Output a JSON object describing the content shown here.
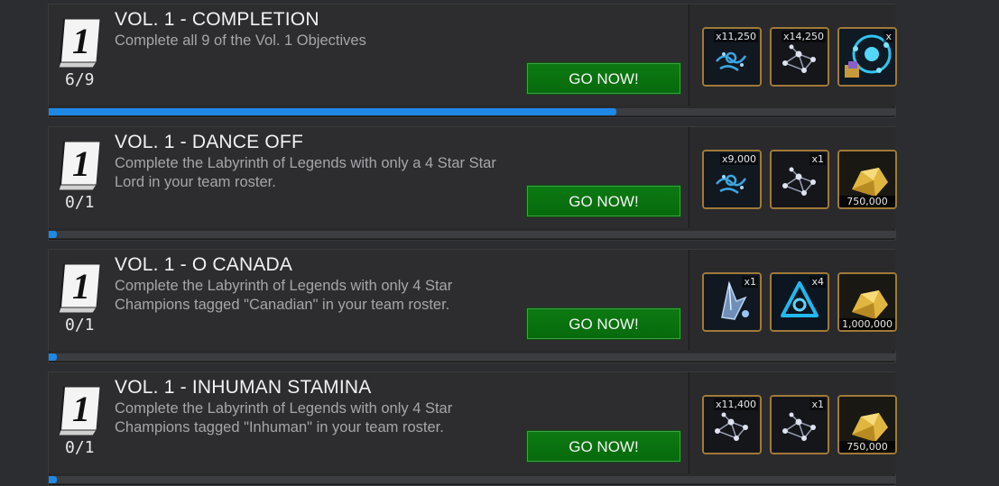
{
  "colors": {
    "accent_progress": "#1e88e5",
    "button_green": "#0b7510",
    "reward_border": "#a07a38"
  },
  "objectives": [
    {
      "book_number": "1",
      "title": "VOL. 1 - COMPLETION",
      "description": "Complete all 9 of the Vol. 1 Objectives",
      "count": "6/9",
      "progress": 0.67,
      "button_label": "GO NOW!",
      "rewards": [
        {
          "icon": "catalyst-fragment-icon",
          "label": "x11,250"
        },
        {
          "icon": "catalyst-shard-icon",
          "label": "x14,250"
        },
        {
          "icon": "crystal-bundle-icon",
          "label": "x"
        }
      ]
    },
    {
      "book_number": "1",
      "title": "VOL. 1 - DANCE OFF",
      "description": "Complete the Labyrinth of Legends with only a 4 Star Star Lord in your team roster.",
      "count": "0/1",
      "progress": 0.01,
      "button_label": "GO NOW!",
      "rewards": [
        {
          "icon": "catalyst-fragment-icon",
          "label": "x9,000"
        },
        {
          "icon": "catalyst-shard-icon",
          "label": "x1"
        },
        {
          "icon": "gold-icon",
          "label": "750,000"
        }
      ]
    },
    {
      "book_number": "1",
      "title": "VOL. 1 - O CANADA",
      "description": "Complete the Labyrinth of Legends with only 4 Star Champions tagged \"Canadian\" in your team roster.",
      "count": "0/1",
      "progress": 0.01,
      "button_label": "GO NOW!",
      "rewards": [
        {
          "icon": "shard-crystal-icon",
          "label": "x1"
        },
        {
          "icon": "signature-stone-icon",
          "label": "x4"
        },
        {
          "icon": "gold-icon",
          "label": "1,000,000"
        }
      ]
    },
    {
      "book_number": "1",
      "title": "VOL. 1 - INHUMAN STAMINA",
      "description": "Complete the Labyrinth of Legends with only 4 Star Champions tagged \"Inhuman\" in your team roster.",
      "count": "0/1",
      "progress": 0.01,
      "button_label": "GO NOW!",
      "rewards": [
        {
          "icon": "catalyst-shard-icon",
          "label": "x11,400"
        },
        {
          "icon": "catalyst-shard-icon",
          "label": "x1"
        },
        {
          "icon": "gold-icon",
          "label": "750,000"
        }
      ]
    }
  ]
}
